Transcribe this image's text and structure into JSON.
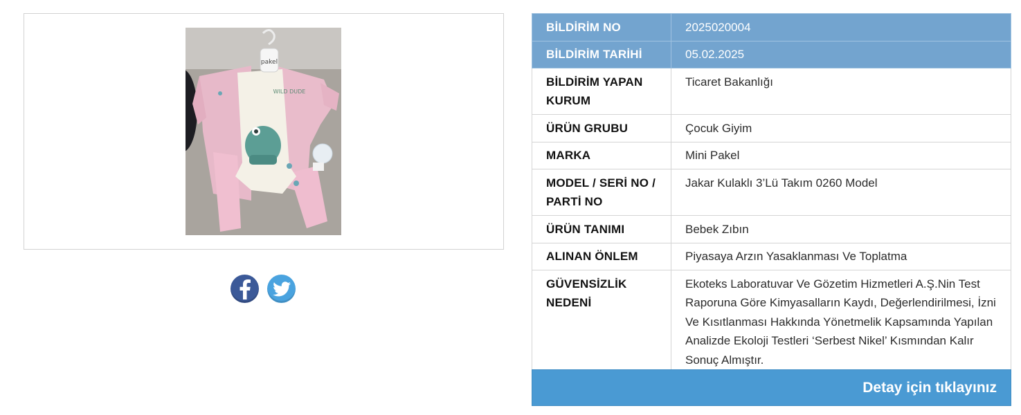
{
  "product": {
    "photo_alt": "Mini Pakel bebek takımı",
    "tag_text": "pakel",
    "print_text": "WILD DUDE"
  },
  "social": {
    "facebook_icon": "facebook-icon",
    "twitter_icon": "twitter-icon"
  },
  "rows": [
    {
      "label": "BİLDİRİM NO",
      "value": "2025020004",
      "highlight": true
    },
    {
      "label": "BİLDİRİM TARİHİ",
      "value": "05.02.2025",
      "highlight": true
    },
    {
      "label": "BİLDİRİM YAPAN KURUM",
      "value": "Ticaret Bakanlığı",
      "highlight": false
    },
    {
      "label": "ÜRÜN GRUBU",
      "value": "Çocuk Giyim",
      "highlight": false
    },
    {
      "label": "MARKA",
      "value": "Mini Pakel",
      "highlight": false
    },
    {
      "label": "MODEL / SERİ NO / PARTİ NO",
      "value": "Jakar Kulaklı 3’Lü Takım 0260 Model",
      "highlight": false
    },
    {
      "label": "ÜRÜN TANIMI",
      "value": "Bebek Zıbın",
      "highlight": false
    },
    {
      "label": "ALINAN ÖNLEM",
      "value": "Piyasaya Arzın Yasaklanması Ve Toplatma",
      "highlight": false
    },
    {
      "label": "GÜVENSİZLİK NEDENİ",
      "value": "Ekoteks Laboratuvar Ve Gözetim Hizmetleri A.Ş.Nin Test Raporuna Göre Kimyasalların Kaydı, Değerlendirilmesi, İzni Ve Kısıtlanması Hakkında Yönetmelik Kapsamında Yapılan Analizde Ekoloji Testleri ‘Serbest Nikel’ Kısmından Kalır Sonuç Almıştır.",
      "highlight": false
    }
  ],
  "detail_button": "Detay için tıklayınız",
  "colors": {
    "header_row": "#73a4cf",
    "button": "#4a9ad3",
    "facebook": "#3b5998",
    "twitter": "#4aa3df"
  }
}
